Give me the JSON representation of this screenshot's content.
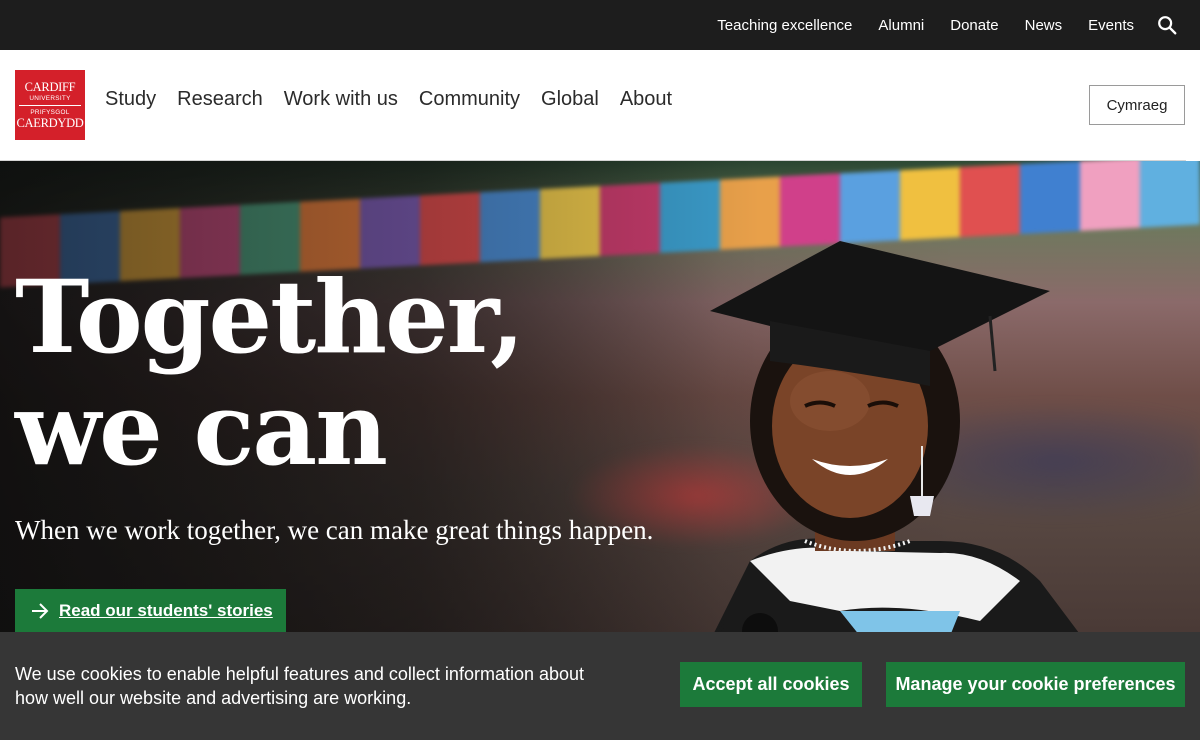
{
  "utility_nav": {
    "links": [
      "Teaching excellence",
      "Alumni",
      "Donate",
      "News",
      "Events"
    ],
    "search_icon": "search-icon"
  },
  "logo": {
    "line1": "CARDIFF",
    "line2": "UNIVERSITY",
    "line3": "PRIFYSGOL",
    "line4": "CAERDYDD"
  },
  "main_nav": {
    "items": [
      "Study",
      "Research",
      "Work with us",
      "Community",
      "Global",
      "About"
    ]
  },
  "language_button": "Cymraeg",
  "hero": {
    "title_line1": "Together,",
    "title_line2": "we can",
    "subtitle": "When we work together, we can make great things happen.",
    "cta_label": "Read our students' stories",
    "cta_icon": "arrow-right-icon"
  },
  "cookie_banner": {
    "text": "We use cookies to enable helpful features and collect information about how well our website and advertising are working.",
    "accept_label": "Accept all cookies",
    "manage_label": "Manage your cookie preferences"
  },
  "colors": {
    "utility_bar": "#1d1d1d",
    "brand_red": "#d4202a",
    "cta_green": "#1c7a3a",
    "cookie_bg": "#363636"
  }
}
